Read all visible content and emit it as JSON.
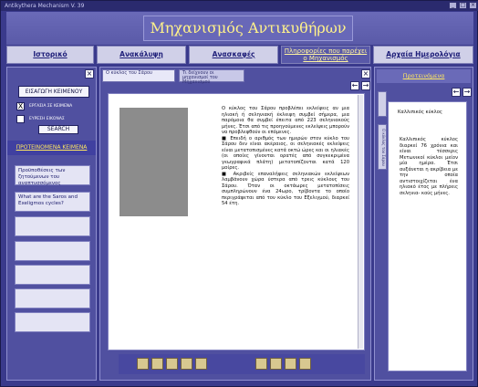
{
  "window": {
    "title": "Antikythera Mechanism V. 39",
    "controls": [
      "_",
      "□",
      "×"
    ]
  },
  "banner": {
    "title": "Μηχανισμός Αντικυθήρων"
  },
  "nav": {
    "tabs": [
      {
        "label": "Ιστορικό"
      },
      {
        "label": "Ανακάλυψη"
      },
      {
        "label": "Ανασκαφές"
      },
      {
        "label": "Πληροφορίες που παρέχει ο Μηχανισμός"
      },
      {
        "label": "Αρχαία Ημερολόγια"
      }
    ]
  },
  "sidebar": {
    "close": "×",
    "insert_text_button": "ΕΙΣΑΓΩΓΗ ΚΕΙΜΕΝΟΥ",
    "check1": {
      "mark": "X",
      "label": "ΕΡΓΑΣΙΑ ΣΕ ΚΕΙΜΕΝΑ"
    },
    "check2": {
      "mark": "",
      "label": "ΕΥΡΕΣΗ ΕΙΚΟΝΑΣ"
    },
    "search_button": "SEARCH",
    "heading": "ΠΡΟΤΕΙΝΟΜΕΝΑ ΚΕΙΜΕΝΑ",
    "items": [
      {
        "label": "Προϋποθέσεις των ζητούμενων του αναπτυσσόμενος"
      },
      {
        "label": "What are the Saros and Exeligmos cycles?"
      },
      {
        "label": ""
      },
      {
        "label": ""
      },
      {
        "label": ""
      },
      {
        "label": ""
      },
      {
        "label": ""
      }
    ]
  },
  "main": {
    "tabs": [
      {
        "label": "Ο κύκλος του Σάρου"
      },
      {
        "label": "Τι δείχνουν οι μηχανισμοί του Μηχανισμού"
      }
    ],
    "controls": [
      "←",
      "→",
      "×"
    ],
    "paragraphs": [
      "Ο κύκλος του Σάρου προβλέπει εκλείψεις αν μια ηλιακή ή σεληνιακή έκλειψη συμβεί σήμερα, μια παρόμοια θα συμβεί έπειτα από 223 σεληνιακούς μήνες. Έτσι από τις προηγούμενες εκλείψεις μπορούν να προβλεφθούν οι επόμενες.",
      "■ Επειδή ο αριθμός των ημερών στον κύκλο του Σάρου δεν είναι ακέραιος, οι σεληνιακές εκλείψεις είναι μετατοπισμένες κατά οκτώ ώρες και οι ηλιακές (οι οποίες γίνονται ορατές από συγκεκριμένα γεωγραφικά πλάτη) μετατοπίζονται κατά 120 μοίρες.",
      "■ Ακριβείς επαναλήψεις σεληνιακών εκλείψεων λαμβάνουν χώρα ύστερα από τρεις κύκλους του Σάρου. Όταν οι οκτάωρες μετατοπίσεις συμπληρώνουν ένα 24ωρο, τρίβοντα το οποίο περιγράφεται από τον κύκλο του Εξελιγμού, διαρκεί 54 έτη."
    ],
    "tools": [
      "tool1",
      "tool2",
      "tool3",
      "tool4",
      "tool5",
      "tool6",
      "tool7",
      "tool8",
      "tool9"
    ]
  },
  "right_panel": {
    "heading": "Προτεινόμενα",
    "controls": [
      "←",
      "→"
    ],
    "vtabs": [
      "",
      "Ο κύκλος του Σάρου"
    ],
    "title": "Καλλιπικός κύκλος",
    "text": "Καλλιπικός κύκλος διαρκεί 76 χρόνια και είναι τέσσερις Μετωνικοί κύκλοι μείον μία ημέρα. Έτσι αυξάνεται η ακρίβεια με την οποία αντιστοιχίζεται ένα ηλιακό έτος με πλήρεις σεληνια- κούς μήνες."
  }
}
